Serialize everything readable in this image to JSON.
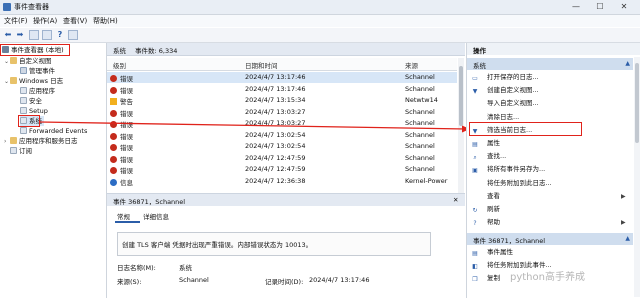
{
  "window": {
    "title": "事件查看器"
  },
  "menu": [
    "文件(F)",
    "操作(A)",
    "查看(V)",
    "帮助(H)"
  ],
  "tree": {
    "root": "事件查看器 (本地)",
    "custom_views": "自定义视图",
    "admin_events": "管理事件",
    "windows_logs": "Windows 日志",
    "application": "应用程序",
    "security": "安全",
    "setup": "Setup",
    "system": "系统",
    "forwarded": "Forwarded Events",
    "app_services": "应用程序和服务日志",
    "subscriptions": "订阅"
  },
  "center": {
    "header_title": "系统",
    "header_count": "事件数: 6,334",
    "columns": [
      "级别",
      "日期和时间",
      "来源"
    ],
    "rows": [
      {
        "level": "错误",
        "icon": "error-icon",
        "datetime": "2024/4/7 13:17:46",
        "source": "Schannel"
      },
      {
        "level": "错误",
        "icon": "error-icon",
        "datetime": "2024/4/7 13:17:46",
        "source": "Schannel"
      },
      {
        "level": "警告",
        "icon": "warning-icon",
        "datetime": "2024/4/7 13:15:34",
        "source": "Netwtw14"
      },
      {
        "level": "错误",
        "icon": "error-icon",
        "datetime": "2024/4/7 13:03:27",
        "source": "Schannel"
      },
      {
        "level": "错误",
        "icon": "error-icon",
        "datetime": "2024/4/7 13:03:27",
        "source": "Schannel"
      },
      {
        "level": "错误",
        "icon": "error-icon",
        "datetime": "2024/4/7 13:02:54",
        "source": "Schannel"
      },
      {
        "level": "错误",
        "icon": "error-icon",
        "datetime": "2024/4/7 13:02:54",
        "source": "Schannel"
      },
      {
        "level": "错误",
        "icon": "error-icon",
        "datetime": "2024/4/7 12:47:59",
        "source": "Schannel"
      },
      {
        "level": "错误",
        "icon": "error-icon",
        "datetime": "2024/4/7 12:47:59",
        "source": "Schannel"
      },
      {
        "level": "信息",
        "icon": "info-icon",
        "datetime": "2024/4/7 12:36:38",
        "source": "Kernel-Power"
      }
    ],
    "detail": {
      "header": "事件 36871，Schannel",
      "tabs": [
        "常规",
        "详细信息"
      ],
      "message": "创建 TLS 客户端 凭据时出现严重错误。内部错误状态为 10013。",
      "log_name_label": "日志名称(M):",
      "log_name_value": "系统",
      "source_label": "来源(S):",
      "source_value": "Schannel",
      "logged_label": "记录时间(D):",
      "logged_value": "2024/4/7 13:17:46"
    }
  },
  "actions": {
    "header": "操作",
    "section1": "系统",
    "items1": [
      {
        "label": "打开保存的日志...",
        "icon": "folder-icon"
      },
      {
        "label": "创建自定义视图...",
        "icon": "filter-create-icon"
      },
      {
        "label": "导入自定义视图...",
        "icon": ""
      },
      {
        "label": "清除日志...",
        "icon": ""
      },
      {
        "label": "筛选当前日志...",
        "icon": "filter-icon"
      },
      {
        "label": "属性",
        "icon": "properties-icon"
      },
      {
        "label": "查找...",
        "icon": "find-icon"
      },
      {
        "label": "将所有事件另存为...",
        "icon": "save-icon"
      },
      {
        "label": "将任务附加到此日志...",
        "icon": ""
      },
      {
        "label": "查看",
        "icon": "",
        "submenu": "▶"
      },
      {
        "label": "刷新",
        "icon": "refresh-icon"
      },
      {
        "label": "帮助",
        "icon": "help-icon",
        "submenu": "▶"
      }
    ],
    "section2": "事件 36871，Schannel",
    "items2": [
      {
        "label": "事件属性",
        "icon": "event-properties-icon"
      },
      {
        "label": "将任务附加到此事件...",
        "icon": "task-icon"
      },
      {
        "label": "复制",
        "icon": "copy-icon"
      }
    ]
  },
  "watermark": "python高手养成",
  "colors": {
    "annotation_red": "#e0231b",
    "selection": "#d7e6f7",
    "error": "#c42b1c",
    "warning": "#f2b01e",
    "info": "#2b6cc4"
  }
}
